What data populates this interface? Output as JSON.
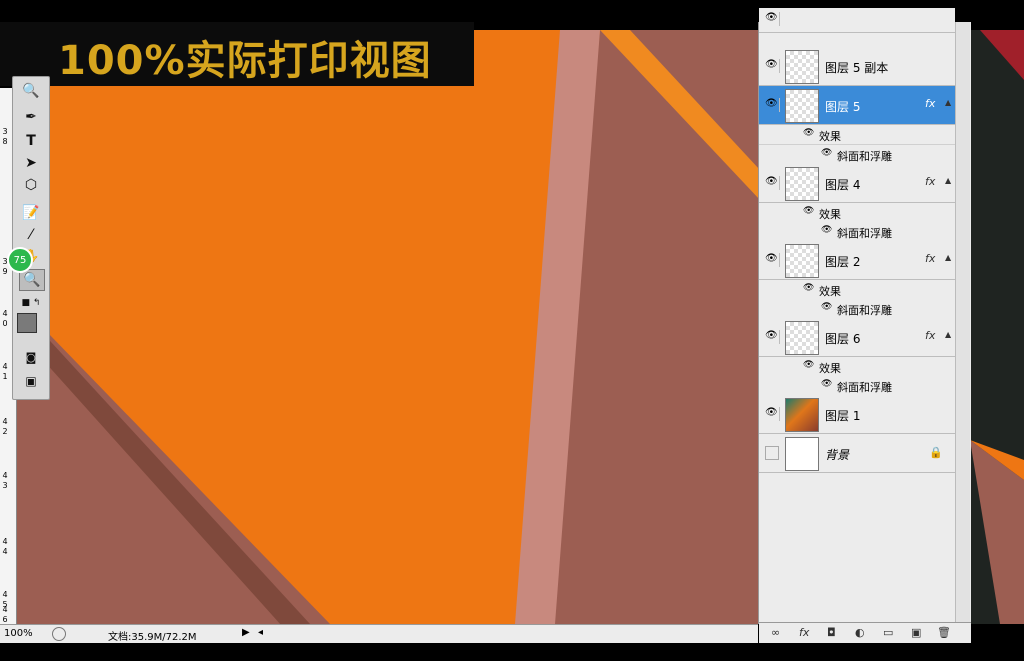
{
  "banner": {
    "title": "100%实际打印视图"
  },
  "toolbox": {
    "zoom_badge": "75",
    "tools": [
      "zoom-tool",
      "pen-tool",
      "type-tool",
      "path-select-tool",
      "shape-tool",
      "notes-tool",
      "eyedropper-tool",
      "hand-tool",
      "zoom-tool-selected",
      "default-colors",
      "swap-colors",
      "foreground-color",
      "quick-mask",
      "screen-mode"
    ]
  },
  "ruler": {
    "ticks": [
      "3",
      "8",
      "3",
      "9",
      "4",
      "0",
      "4",
      "1",
      "4",
      "2",
      "4",
      "3",
      "4",
      "4",
      "4",
      "5",
      "4",
      "6"
    ]
  },
  "status": {
    "zoom": "100%",
    "doc": "文档:35.9M/72.2M"
  },
  "layers": {
    "rows": [
      {
        "name": "图层 5 副本",
        "selected": false,
        "fx": false,
        "thumb": "checker"
      },
      {
        "name": "图层 5",
        "selected": true,
        "fx": true,
        "thumb": "checker"
      },
      {
        "name": "图层 4",
        "selected": false,
        "fx": true,
        "thumb": "checker"
      },
      {
        "name": "图层 2",
        "selected": false,
        "fx": true,
        "thumb": "checker"
      },
      {
        "name": "图层 6",
        "selected": false,
        "fx": true,
        "thumb": "checker"
      },
      {
        "name": "图层 1",
        "selected": false,
        "fx": false,
        "thumb": "photo"
      },
      {
        "name": "背景",
        "selected": false,
        "fx": false,
        "thumb": "solid",
        "locked": true
      }
    ],
    "effect_label": "效果",
    "effect_item": "斜面和浮雕",
    "fx_label": "fx"
  },
  "colors": {
    "orange": "#ee7613",
    "brown": "#9c5e52",
    "accent": "#3b8bd8",
    "banner_text": "#d6a51e"
  }
}
